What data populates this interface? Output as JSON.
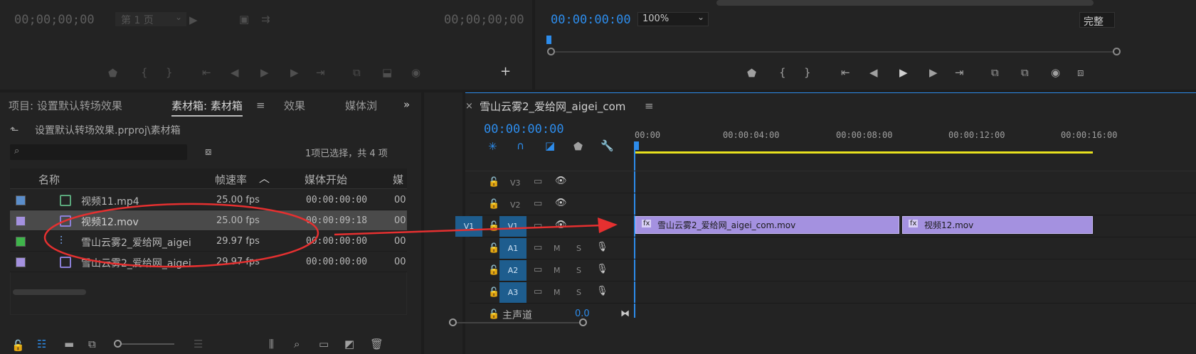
{
  "source_monitor": {
    "timecode_left": "00;00;00;00",
    "page_select": "第 1 页",
    "timecode_right": "00;00;00;00"
  },
  "program_monitor": {
    "timecode": "00:00:00:00",
    "zoom": "100%",
    "quality": "完整"
  },
  "project_panel": {
    "tabs": [
      "项目: 设置默认转场效果",
      "素材箱: 素材箱",
      "效果",
      "媒体浏"
    ],
    "path": "设置默认转场效果.prproj\\素材箱",
    "selection_status": "1项已选择，共 4 项",
    "columns": [
      "名称",
      "帧速率",
      "媒体开始",
      "媒"
    ],
    "items": [
      {
        "name": "视频11.mp4",
        "fps": "25.00 fps",
        "start": "00:00:00:00",
        "more": "00",
        "color": "#5b8ecb"
      },
      {
        "name": "视频12.mov",
        "fps": "25.00 fps",
        "start": "00:00:09:18",
        "more": "00",
        "color": "#a491e0"
      },
      {
        "name": "雪山云雾2_爱给网_aigei",
        "fps": "29.97 fps",
        "start": "00:00:00:00",
        "more": "00",
        "color": "#3fb54b"
      },
      {
        "name": "雪山云雾2_爱给网_aigei",
        "fps": "29.97 fps",
        "start": "00:00:00:00",
        "more": "00",
        "color": "#a491e0"
      }
    ]
  },
  "timeline": {
    "sequence_name": "雪山云雾2_爱给网_aigei_com",
    "timecode": "00:00:00:00",
    "ruler": [
      "00:00",
      "00:00:04:00",
      "00:00:08:00",
      "00:00:12:00",
      "00:00:16:00"
    ],
    "tracks": {
      "video": [
        "V3",
        "V2",
        "V1"
      ],
      "audio": [
        "A1",
        "A2",
        "A3"
      ],
      "source_v1": "V1",
      "mute": "M",
      "solo": "S"
    },
    "master": {
      "label": "主声道",
      "value": "0.0"
    },
    "clips": [
      {
        "fx": "fx",
        "name": "雪山云雾2_爱给网_aigei_com.mov"
      },
      {
        "fx": "fx",
        "name": "视频12.mov"
      }
    ]
  },
  "colors": {
    "accent": "#2d8ceb",
    "clip": "#a491e0",
    "annotation": "#e53030",
    "render_bar": "#e8e11e"
  }
}
